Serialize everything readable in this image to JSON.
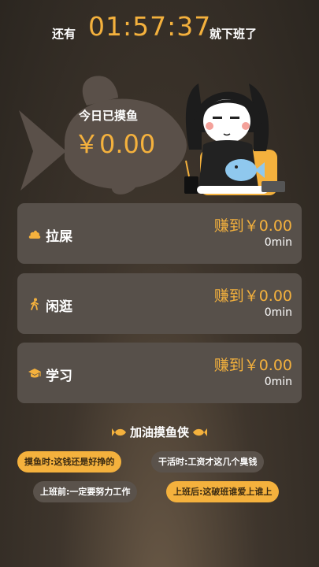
{
  "countdown": {
    "prefix": "还有",
    "time": "01:57:37",
    "suffix": "就下班了"
  },
  "today": {
    "label": "今日已摸鱼",
    "amount": "￥0.00"
  },
  "activities": [
    {
      "name": "拉屎",
      "earned": "赚到￥0.00",
      "duration": "0min",
      "icon": "poop-icon"
    },
    {
      "name": "闲逛",
      "earned": "赚到￥0.00",
      "duration": "0min",
      "icon": "walking-icon"
    },
    {
      "name": "学习",
      "earned": "赚到￥0.00",
      "duration": "0min",
      "icon": "graduation-cap-icon"
    }
  ],
  "cheer": {
    "title": "加油摸鱼侠",
    "tags": [
      "摸鱼时:这钱还是好挣的",
      "干活时:工资才这几个臭钱",
      "上班前:一定要努力工作",
      "上班后:这破班谁爱上谁上"
    ]
  },
  "colors": {
    "accent": "#f4b13d",
    "card": "#57504a",
    "background": "#2b2620"
  }
}
